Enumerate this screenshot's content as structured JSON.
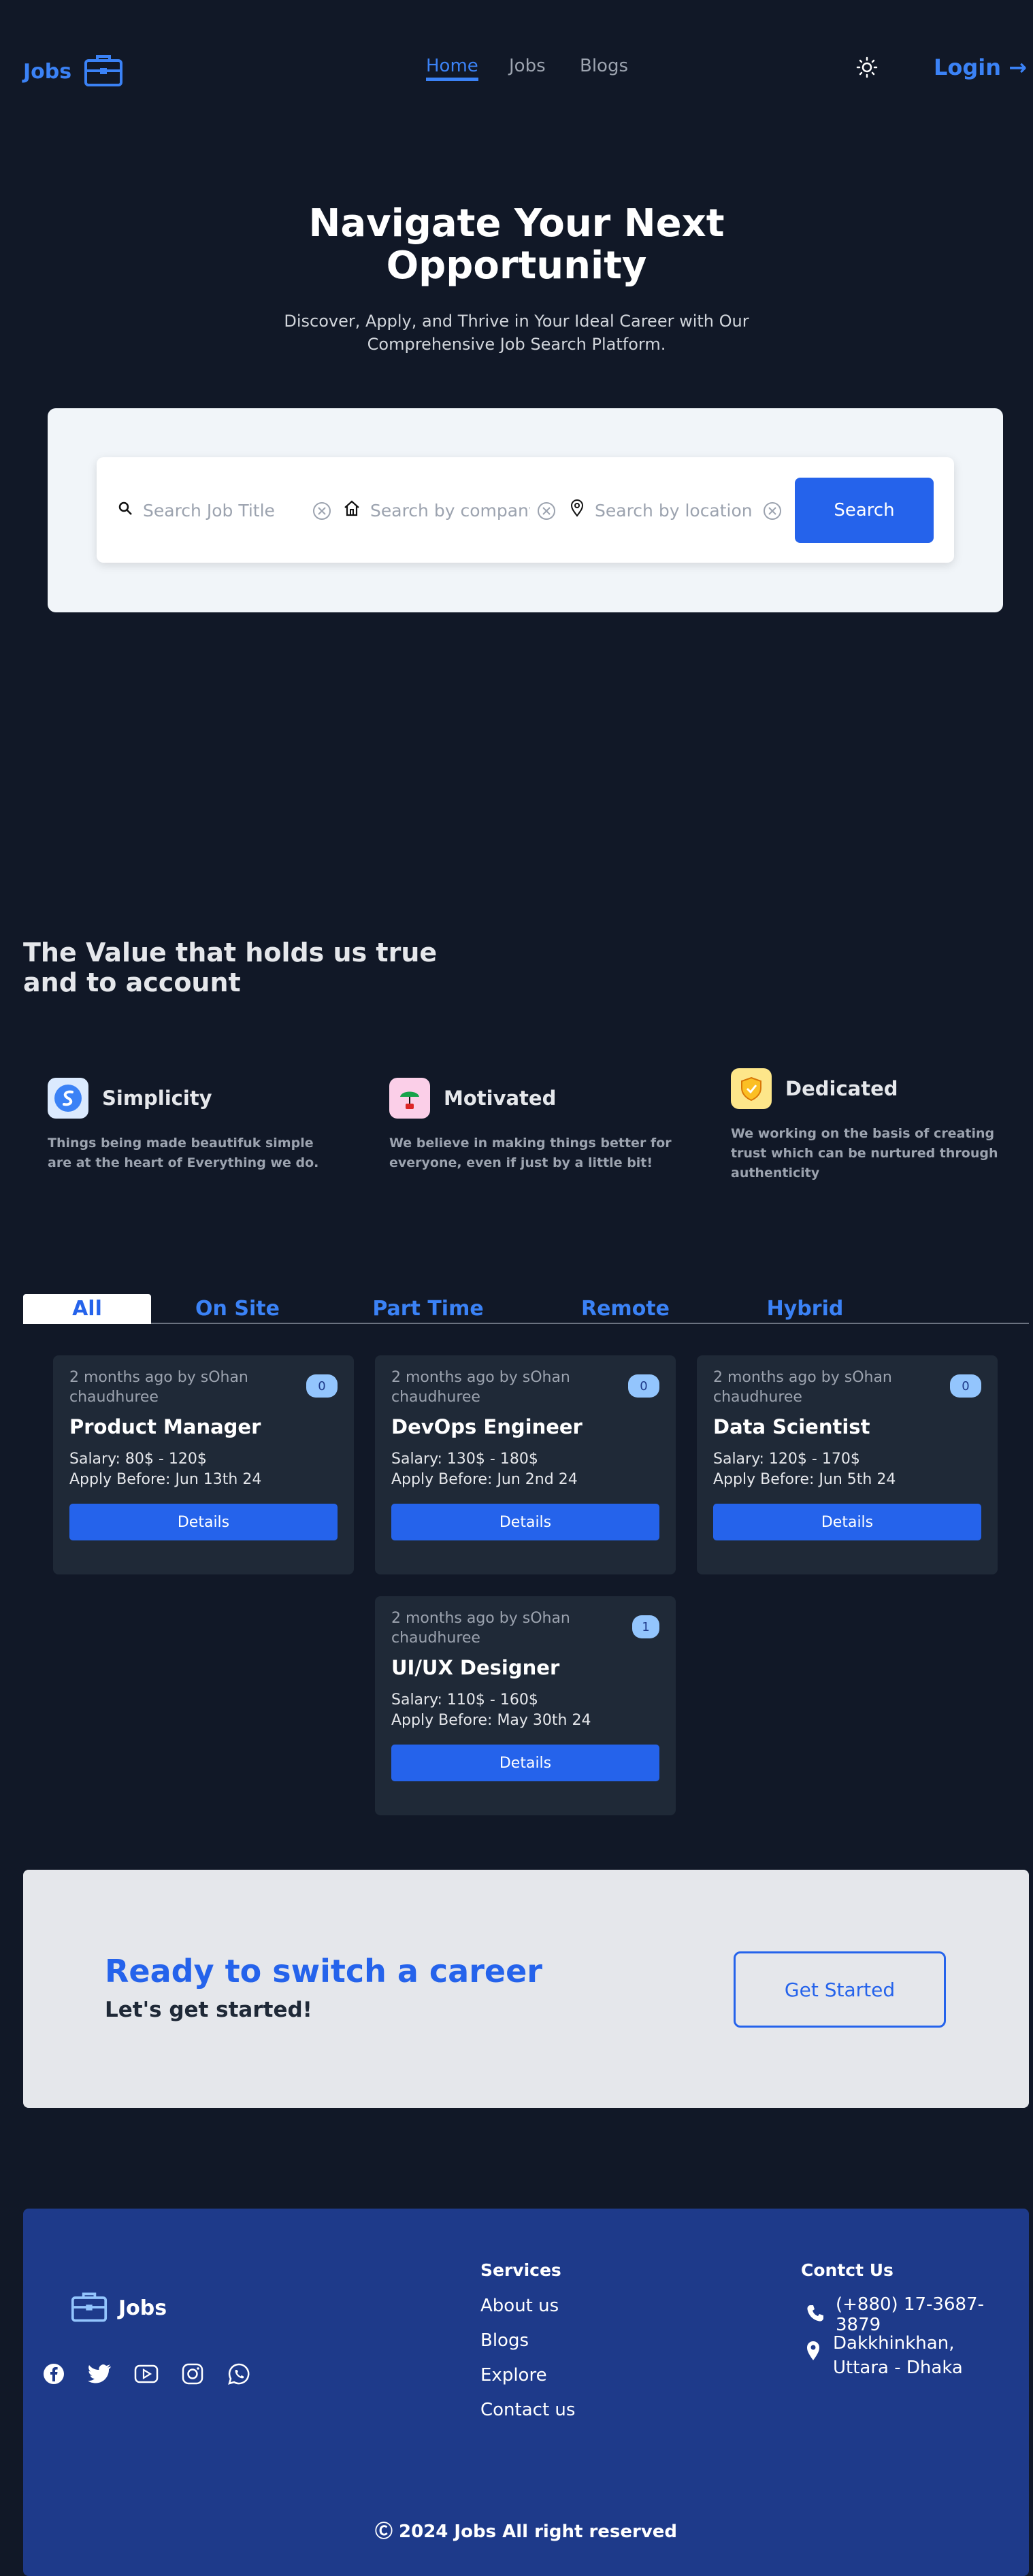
{
  "nav": {
    "logo_text": "Jobs",
    "links": [
      "Home",
      "Jobs",
      "Blogs"
    ],
    "login_label": "Login →"
  },
  "hero": {
    "title_line1": "Navigate Your Next",
    "title_line2": "Opportunity",
    "subtitle_line1": "Discover, Apply, and Thrive in Your Ideal Career with Our",
    "subtitle_line2": "Comprehensive Job Search Platform.",
    "search": {
      "job_placeholder": "Search Job Title",
      "company_placeholder": "Search by company",
      "location_placeholder": "Search by location",
      "button_label": "Search"
    }
  },
  "values": {
    "title_line1": "The Value that holds us true",
    "title_line2": "and to account",
    "items": [
      {
        "title": "Simplicity",
        "desc_line1": "Things being made beautifuk simple",
        "desc_line2": "are at the heart of Everything we do.",
        "desc_line3": ""
      },
      {
        "title": "Motivated",
        "desc_line1": "We believe in making things better for",
        "desc_line2": "everyone, even if just by a little bit!",
        "desc_line3": ""
      },
      {
        "title": "Dedicated",
        "desc_line1": "We working on the basis of creating",
        "desc_line2": "trust which can be nurtured through",
        "desc_line3": "authenticity"
      }
    ]
  },
  "tabs": [
    "All",
    "On Site",
    "Part Time",
    "Remote",
    "Hybrid"
  ],
  "jobs": [
    {
      "meta_line1": "2 months ago by sOhan",
      "meta_line2": "chaudhuree",
      "badge": "0",
      "title": "Product Manager",
      "salary": "Salary: 80$ - 120$",
      "apply": "Apply Before: Jun 13th 24",
      "button": "Details"
    },
    {
      "meta_line1": "2 months ago by sOhan",
      "meta_line2": "chaudhuree",
      "badge": "0",
      "title": "DevOps Engineer",
      "salary": "Salary: 130$ - 180$",
      "apply": "Apply Before: Jun 2nd 24",
      "button": "Details"
    },
    {
      "meta_line1": "2 months ago by sOhan",
      "meta_line2": "chaudhuree",
      "badge": "0",
      "title": "Data Scientist",
      "salary": "Salary: 120$ - 170$",
      "apply": "Apply Before: Jun 5th 24",
      "button": "Details"
    },
    {
      "meta_line1": "2 months ago by sOhan",
      "meta_line2": "chaudhuree",
      "badge": "1",
      "title": "UI/UX Designer",
      "salary": "Salary: 110$ - 160$",
      "apply": "Apply Before: May 30th 24",
      "button": "Details"
    }
  ],
  "cta": {
    "title": "Ready to switch a career",
    "subtitle": "Let's get started!",
    "button": "Get Started"
  },
  "footer": {
    "logo_text": "Jobs",
    "services_heading": "Services",
    "services": [
      "About us",
      "Blogs",
      "Explore",
      "Contact us"
    ],
    "contact_heading": "Contct Us",
    "phone": "(+880) 17-3687-3879",
    "address_line1": "Dakkhinkhan,",
    "address_line2": "Uttara - Dhaka",
    "copyright": "Ⓒ 2024 Jobs All right reserved"
  },
  "colors": {
    "background": "#111827",
    "accent": "#2563eb",
    "card": "#1f2937",
    "footer": "#1e3a8a"
  }
}
